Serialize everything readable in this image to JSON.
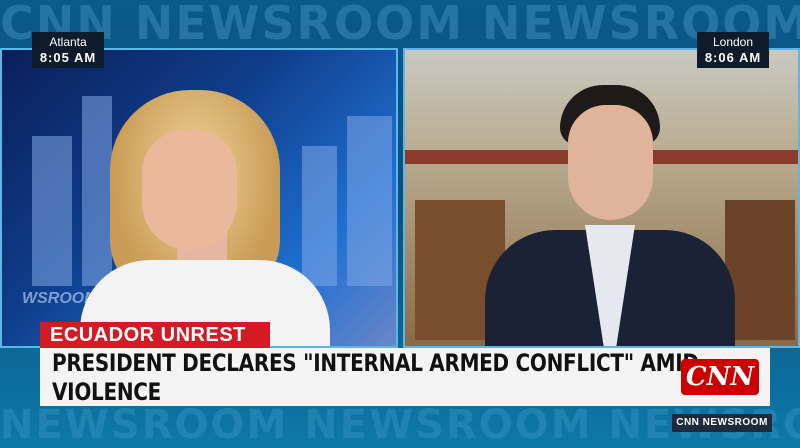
{
  "background": {
    "watermark_top": "CNN NEWSROOM NEWSROOM NEWSROOM",
    "watermark_bottom": "NEWSROOM NEWSROOM NEWSROOM",
    "set_text": "WSROOM"
  },
  "clocks": {
    "left": {
      "city": "Atlanta",
      "time": "8:05 AM"
    },
    "right": {
      "city": "London",
      "time": "8:06 AM"
    }
  },
  "lower_third": {
    "tag": "ECUADOR UNREST",
    "headline": "PRESIDENT DECLARES \"INTERNAL ARMED CONFLICT\" AMID VIOLENCE"
  },
  "logo": {
    "text": "CNN"
  },
  "bug": {
    "text": "CNN NEWSROOM"
  },
  "colors": {
    "accent_red": "#d31b25",
    "logo_red": "#cc0000",
    "frame_blue": "#5cb7e6"
  }
}
